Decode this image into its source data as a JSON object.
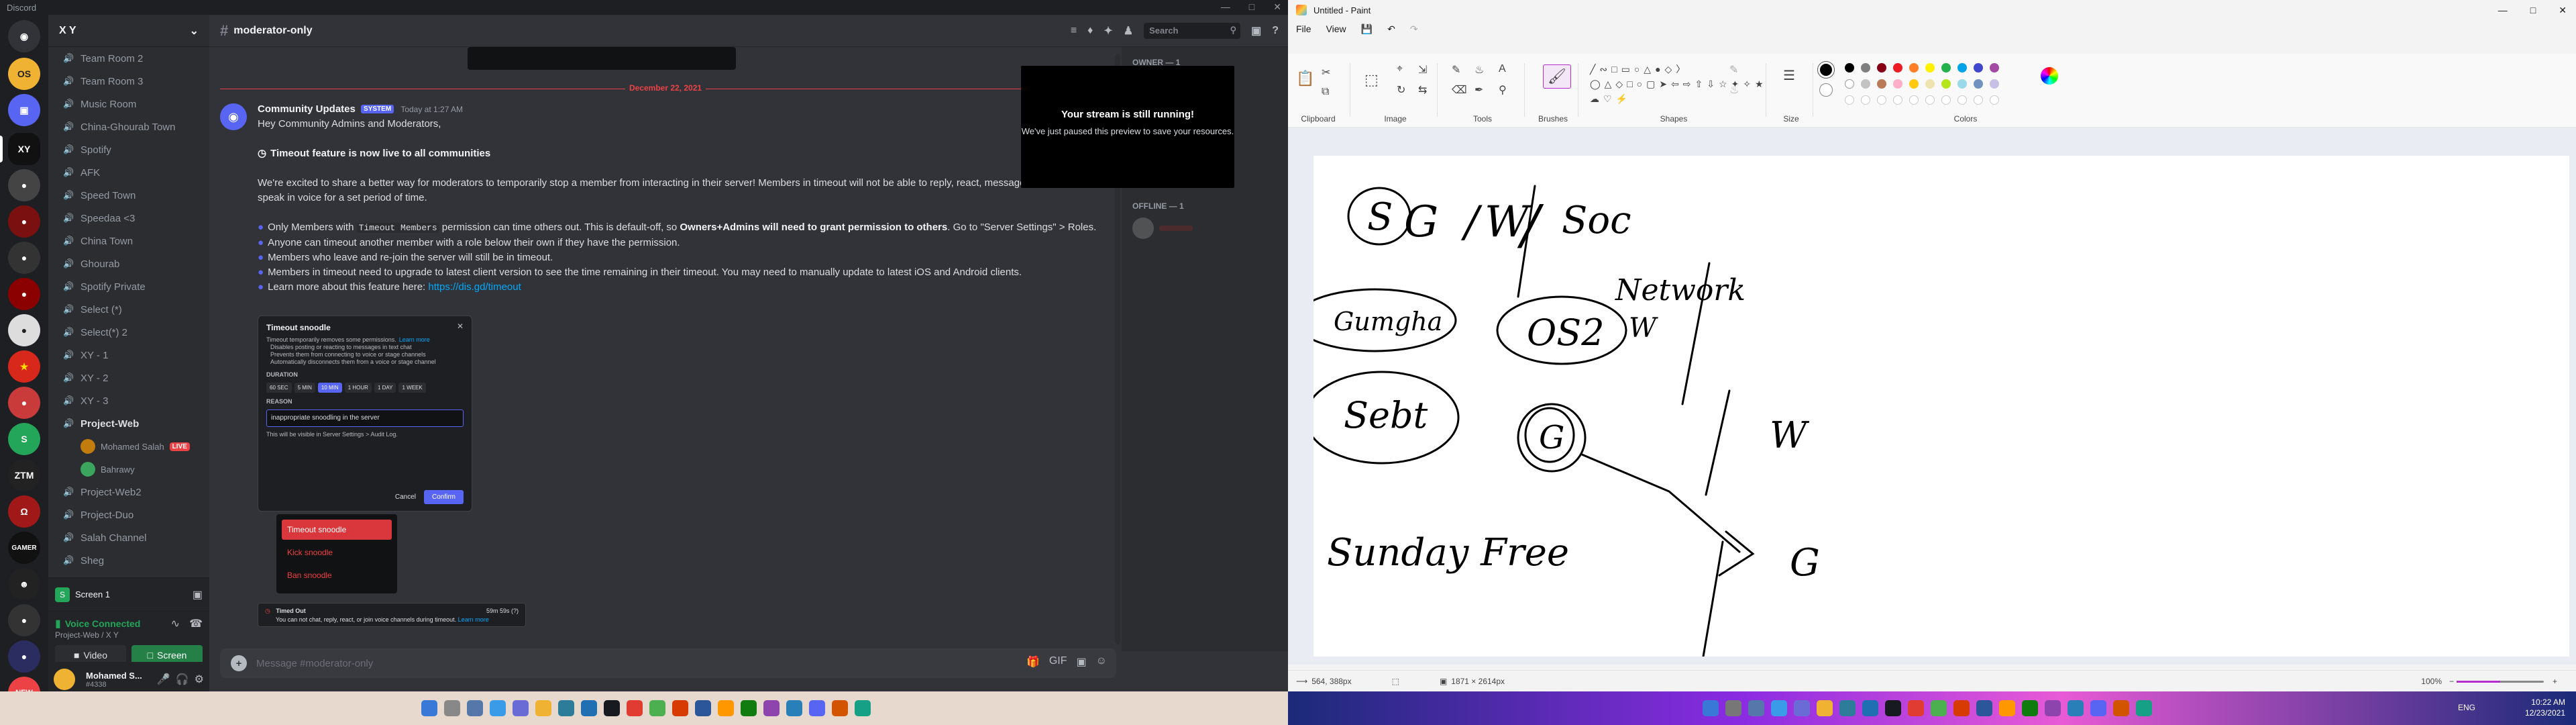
{
  "discord": {
    "app_name": "Discord",
    "server_name": "X Y",
    "channels": [
      {
        "name": "Team Room 2",
        "type": "voice"
      },
      {
        "name": "Team Room 3",
        "type": "voice"
      },
      {
        "name": "Music Room",
        "type": "voice"
      },
      {
        "name": "China-Ghourab Town",
        "type": "voice"
      },
      {
        "name": "Spotify",
        "type": "voice"
      },
      {
        "name": "AFK",
        "type": "voice"
      },
      {
        "name": "Speed Town",
        "type": "voice"
      },
      {
        "name": "Speedaa <3",
        "type": "voice"
      },
      {
        "name": "China Town",
        "type": "voice"
      },
      {
        "name": "Ghourab",
        "type": "voice"
      },
      {
        "name": "Spotify Private",
        "type": "voice"
      },
      {
        "name": "Select (*)",
        "type": "voice"
      },
      {
        "name": "Select(*) 2",
        "type": "voice"
      },
      {
        "name": "XY - 1",
        "type": "voice"
      },
      {
        "name": "XY - 2",
        "type": "voice"
      },
      {
        "name": "XY - 3",
        "type": "voice"
      },
      {
        "name": "Project-Web",
        "type": "voice-active"
      },
      {
        "name": "Mohamed Salah",
        "type": "user",
        "live": "LIVE"
      },
      {
        "name": "Bahrawy",
        "type": "user"
      },
      {
        "name": "Project-Web2",
        "type": "voice"
      },
      {
        "name": "Project-Duo",
        "type": "voice"
      },
      {
        "name": "Salah Channel",
        "type": "voice"
      },
      {
        "name": "Sheg",
        "type": "voice"
      }
    ],
    "stream": {
      "title": "Screen 1"
    },
    "voice": {
      "status": "Voice Connected",
      "location": "Project-Web / X Y",
      "video_label": "Video",
      "screen_label": "Screen"
    },
    "user": {
      "name": "Mohamed S...",
      "tag": "#4338"
    },
    "channel_title": "moderator-only",
    "search_placeholder": "Search",
    "date_divider": "December 22, 2021",
    "message": {
      "author": "Community Updates",
      "badge": "SYSTEM",
      "time": "Today at 1:27 AM",
      "greeting": "Hey Community Admins and Moderators,",
      "headline": "Timeout feature is now live to all communities",
      "intro": "We're excited to share a better way for moderators to temporarily stop a member from interacting in their server! Members in timeout will not be able to reply, react, message in threads, or speak in voice for a set period of time.",
      "bullets": [
        {
          "pre": "Only Members with ",
          "code": "Timeout Members",
          "post": " permission can time others out. This is default-off, so ",
          "bold": "Owners+Admins will need to grant permission to others",
          "tail": ". Go to \"Server Settings\" > Roles."
        },
        {
          "pre": "Anyone can timeout another member with a role below their own if they have the permission."
        },
        {
          "pre": "Members who leave and re-join the server will still be in timeout."
        },
        {
          "pre": "Members in timeout need to upgrade to latest client version to see the time remaining in their timeout. You may need to manually update to latest iOS and Android clients."
        },
        {
          "pre": "Learn more about this feature here: ",
          "link": "https://dis.gd/timeout"
        }
      ]
    },
    "modal": {
      "title": "Timeout snoodle",
      "lines": [
        "Timeout temporarily removes some permissions.",
        "Disables posting or reacting to messages in text chat",
        "Prevents them from connecting to voice or stage channels",
        "Automatically disconnects them from a voice or stage channel"
      ],
      "learn_more": "Learn more",
      "duration_label": "DURATION",
      "durations": [
        "60 SEC",
        "5 MIN",
        "10 MIN",
        "1 HOUR",
        "1 DAY",
        "1 WEEK"
      ],
      "reason_label": "REASON",
      "reason": "inappropriate snoodling in the server",
      "footnote": "This will be visible in Server Settings > Audit Log.",
      "cancel": "Cancel",
      "confirm": "Confirm"
    },
    "context_menu": [
      "Timeout snoodle",
      "Kick snoodle",
      "Ban snoodle"
    ],
    "timeout_banner": {
      "title": "Timed Out",
      "text": "You can not chat, reply, react, or join voice channels during timeout.",
      "link": "Learn more",
      "remaining": "59m 59s (?)"
    },
    "toast": {
      "title": "Your stream is still running!",
      "text": "We've just paused this preview to save your resources."
    },
    "members": {
      "online": "OWNER — 1",
      "offline": "OFFLINE — 1"
    },
    "input_placeholder": "Message #moderator-only"
  },
  "paint": {
    "title": "Untitled - Paint",
    "menu": [
      "File",
      "View"
    ],
    "groups": [
      "Clipboard",
      "Image",
      "Tools",
      "Brushes",
      "Shapes",
      "Size",
      "Colors"
    ],
    "colors": [
      "#000000",
      "#7f7f7f",
      "#880015",
      "#ed1c24",
      "#ff7f27",
      "#fff200",
      "#22b14c",
      "#00a2e8",
      "#3f48cc",
      "#a349a4",
      "#ffffff",
      "#c3c3c3",
      "#b97a57",
      "#ffaec9",
      "#ffc90e",
      "#efe4b0",
      "#b5e61d",
      "#99d9ea",
      "#7092be",
      "#c8bfe7"
    ],
    "status": {
      "cursor": "564, 388px",
      "canvas_size": "1871 × 2614px",
      "zoom": "100%",
      "zoom_level": 0.5
    },
    "drawing": {
      "texts": [
        "S",
        "G",
        "/",
        "W",
        "/",
        "Soc",
        "Gumgha",
        "OS2",
        "Network",
        "W",
        "Sebt",
        "G",
        "/",
        "W",
        "Sunday Free",
        "/",
        "G"
      ]
    }
  },
  "taskbar": {
    "lang": "ENG",
    "time": "10:22 AM",
    "date": "12/23/2021"
  }
}
